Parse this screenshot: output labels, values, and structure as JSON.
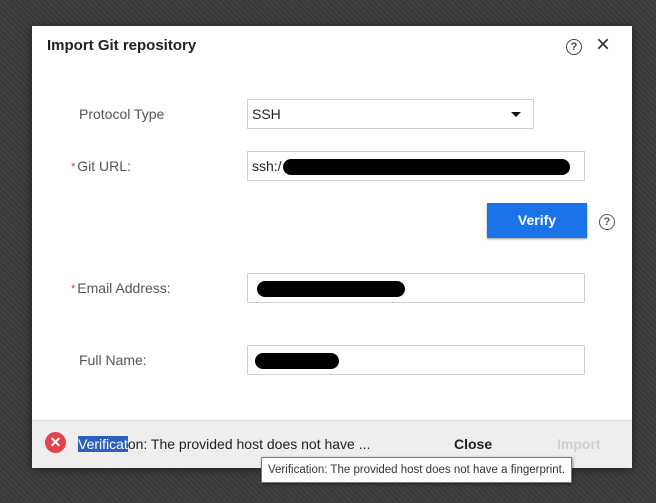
{
  "dialog": {
    "title": "Import Git repository",
    "help_icon_glyph": "?",
    "close_icon_glyph": "×"
  },
  "form": {
    "protocol": {
      "label": "Protocol Type",
      "value": "SSH",
      "options": [
        "SSH"
      ]
    },
    "git_url": {
      "label": "Git URL:",
      "value_prefix": "ssh:/",
      "required": true
    },
    "email": {
      "label": "Email Address:",
      "required": true
    },
    "full_name": {
      "label": "Full Name:"
    },
    "required_mark": "*"
  },
  "verify": {
    "label": "Verify",
    "help_glyph": "?"
  },
  "footer": {
    "error_icon_glyph": "✕",
    "error_selected": "Verificat",
    "error_rest": "on: The provided host does not have ...",
    "close_label": "Close",
    "import_label": "Import"
  },
  "tooltip": {
    "text": "Verification: The provided host does not have a fingerprint."
  },
  "colors": {
    "accent": "#1a73e8",
    "error": "#e0454f",
    "required": "#d9364f"
  }
}
